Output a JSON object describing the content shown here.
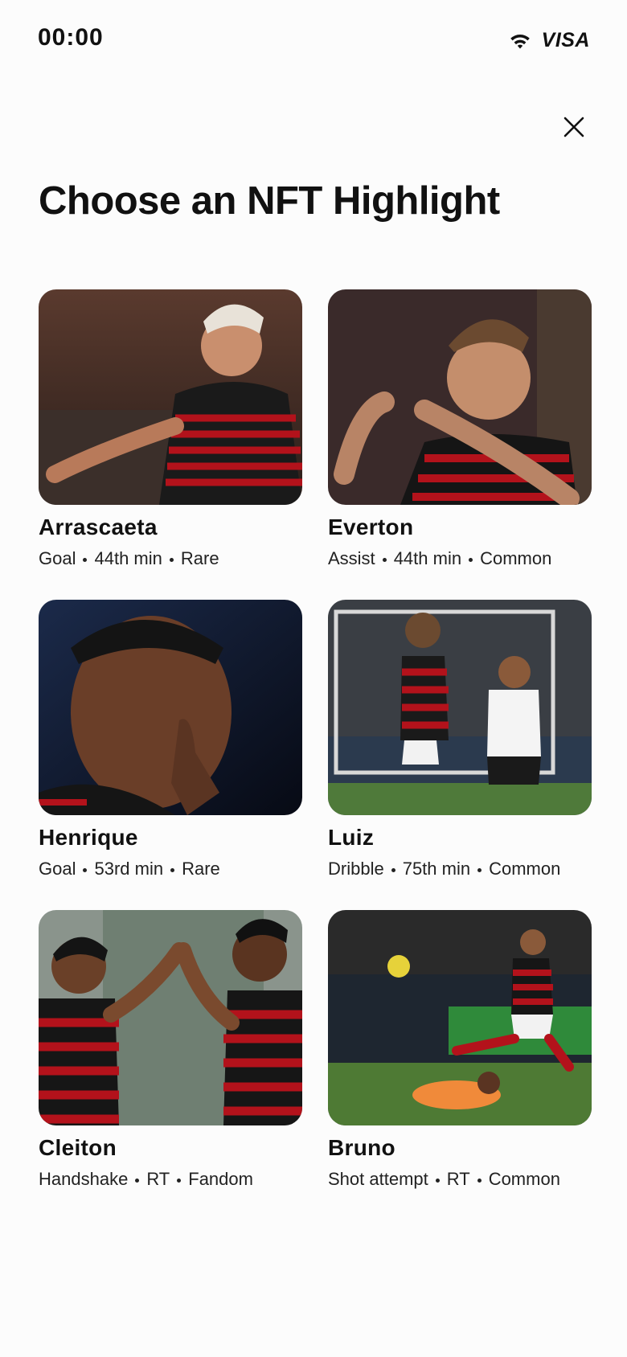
{
  "status": {
    "time": "00:00",
    "carrier": "VISA"
  },
  "header": {
    "title": "Choose an NFT Highlight"
  },
  "cards": [
    {
      "name": "Arrascaeta",
      "action": "Goal",
      "time": "44th min",
      "rarity": "Rare"
    },
    {
      "name": "Everton",
      "action": "Assist",
      "time": "44th min",
      "rarity": "Common"
    },
    {
      "name": "Henrique",
      "action": "Goal",
      "time": "53rd min",
      "rarity": "Rare"
    },
    {
      "name": "Luiz",
      "action": "Dribble",
      "time": "75th min",
      "rarity": "Common"
    },
    {
      "name": "Cleiton",
      "action": "Handshake",
      "time": "RT",
      "rarity": "Fandom"
    },
    {
      "name": "Bruno",
      "action": "Shot attempt",
      "time": "RT",
      "rarity": "Common"
    }
  ],
  "icons": {
    "close": "close-icon",
    "wifi": "wifi-icon"
  }
}
